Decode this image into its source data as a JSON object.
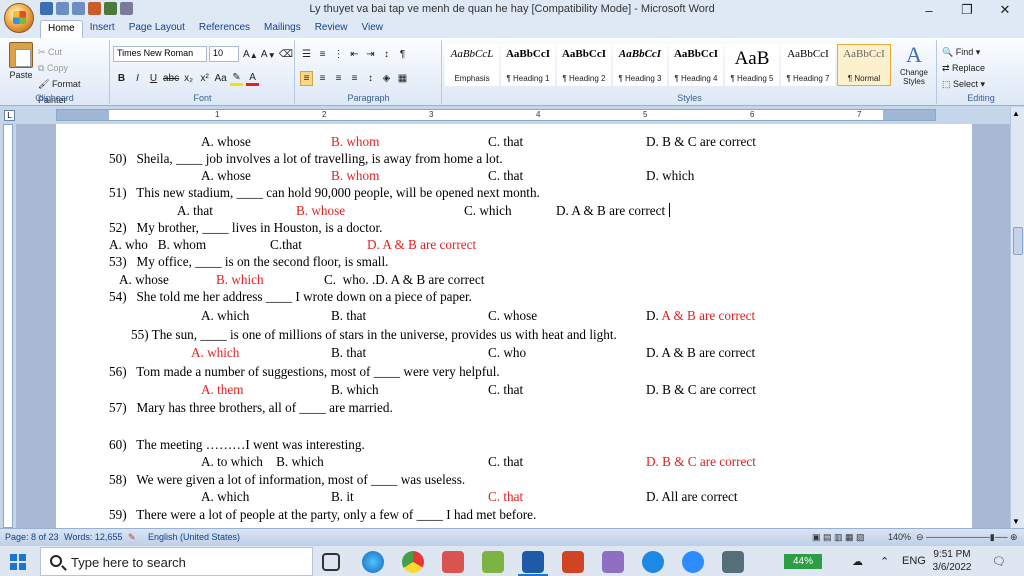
{
  "window": {
    "title": "Ly thuyet va bai tap ve menh de quan he hay [Compatibility Mode] - Microsoft Word",
    "minimize": "–",
    "restore": "❐",
    "close": "✕"
  },
  "tabs": [
    "Home",
    "Insert",
    "Page Layout",
    "References",
    "Mailings",
    "Review",
    "View"
  ],
  "ribbon": {
    "clipboard": {
      "paste": "Paste",
      "cut": "Cut",
      "copy": "Copy",
      "format_painter": "Format Painter",
      "label": "Clipboard"
    },
    "font": {
      "name": "Times New Roman",
      "size": "10",
      "label": "Font"
    },
    "paragraph": {
      "label": "Paragraph"
    },
    "styles": {
      "label": "Styles",
      "items": [
        {
          "preview": "AaBbCcL",
          "name": "Emphasis"
        },
        {
          "preview": "AaBbCcI",
          "name": "¶ Heading 1"
        },
        {
          "preview": "AaBbCcI",
          "name": "¶ Heading 2"
        },
        {
          "preview": "AaBbCcI",
          "name": "¶ Heading 3"
        },
        {
          "preview": "AaBbCcI",
          "name": "¶ Heading 4"
        },
        {
          "preview": "AaB",
          "name": "¶ Heading 5"
        },
        {
          "preview": "AaBbCcI",
          "name": "¶ Heading 7"
        },
        {
          "preview": "AaBbCcI",
          "name": "¶ Normal"
        }
      ],
      "change_styles": "Change Styles"
    },
    "editing": {
      "find": "Find",
      "replace": "Replace",
      "select": "Select",
      "label": "Editing"
    }
  },
  "ruler_numbers": [
    "1",
    "2",
    "3",
    "4",
    "5",
    "6",
    "7"
  ],
  "document": {
    "lines": [
      {
        "segs": [
          {
            "t": "A. whose"
          }
        ]
      },
      {
        "segs": [
          {
            "t": "B. whom",
            "red": true
          }
        ]
      },
      {
        "segs": [
          {
            "t": "C. that"
          }
        ]
      },
      {
        "segs": [
          {
            "t": "D. B & C are correct"
          }
        ]
      },
      {
        "segs": [
          {
            "t": "50)   Sheila, ____ job involves a lot of travelling, is away from home a lot."
          }
        ]
      },
      {
        "segs": [
          {
            "t": "A. whose"
          }
        ]
      },
      {
        "segs": [
          {
            "t": "B. whom",
            "red": true
          }
        ]
      },
      {
        "segs": [
          {
            "t": "C. that"
          }
        ]
      },
      {
        "segs": [
          {
            "t": "D. which"
          }
        ]
      },
      {
        "segs": [
          {
            "t": "51)   This new stadium, ____ can hold 90,000 people, will be opened next month."
          }
        ]
      },
      {
        "segs": [
          {
            "t": "A. that"
          }
        ]
      },
      {
        "segs": [
          {
            "t": "B. whose",
            "red": true
          }
        ]
      },
      {
        "segs": [
          {
            "t": "C. which"
          }
        ]
      },
      {
        "segs": [
          {
            "t": "D. A & B are correct"
          }
        ]
      },
      {
        "segs": [
          {
            "t": "52)   My brother, ____ lives in Houston, is a doctor."
          }
        ]
      },
      {
        "segs": [
          {
            "t": "A. who   B. whom"
          }
        ]
      },
      {
        "segs": [
          {
            "t": "C.that"
          }
        ]
      },
      {
        "segs": [
          {
            "t": "D. A & B are correct",
            "red": true
          }
        ]
      },
      {
        "segs": [
          {
            "t": "53)   My office, ____ is on the second floor, is small."
          }
        ]
      },
      {
        "segs": [
          {
            "t": "A. whose"
          }
        ]
      },
      {
        "segs": [
          {
            "t": "B. which",
            "red": true
          }
        ]
      },
      {
        "segs": [
          {
            "t": "C.  who. .D. A & B are correct"
          }
        ]
      },
      {
        "segs": [
          {
            "t": "54)   She told me her address ____ I wrote down on a piece of paper."
          }
        ]
      },
      {
        "segs": [
          {
            "t": "A. which"
          }
        ]
      },
      {
        "segs": [
          {
            "t": "B. that"
          }
        ]
      },
      {
        "segs": [
          {
            "t": "C. whose"
          }
        ]
      },
      {
        "segs": [
          {
            "t": "D. "
          },
          {
            "t": "A & B are correct",
            "red": true
          }
        ]
      },
      {
        "segs": [
          {
            "t": "55) The sun, ____ is one of millions of stars in the universe, provides us with heat and light."
          }
        ]
      },
      {
        "segs": [
          {
            "t": "A. which",
            "red": true
          }
        ]
      },
      {
        "segs": [
          {
            "t": "B. that"
          }
        ]
      },
      {
        "segs": [
          {
            "t": "C. who"
          }
        ]
      },
      {
        "segs": [
          {
            "t": "D. A & B are correct"
          }
        ]
      },
      {
        "segs": [
          {
            "t": "56)   Tom made a number of suggestions, most of ____ were very helpful."
          }
        ]
      },
      {
        "segs": [
          {
            "t": "A. them",
            "red": true
          }
        ]
      },
      {
        "segs": [
          {
            "t": "B. which"
          }
        ]
      },
      {
        "segs": [
          {
            "t": "C. that"
          }
        ]
      },
      {
        "segs": [
          {
            "t": "D. B & C are correct"
          }
        ]
      },
      {
        "segs": [
          {
            "t": "57)   Mary has three brothers, all of ____ are married."
          }
        ]
      },
      {
        "segs": [
          {
            "t": "60)   The meeting ………I went was interesting."
          }
        ]
      },
      {
        "segs": [
          {
            "t": "A. to which    B. which"
          }
        ]
      },
      {
        "segs": [
          {
            "t": "C. that"
          }
        ]
      },
      {
        "segs": [
          {
            "t": "D. B & C are correct",
            "red": true
          }
        ]
      },
      {
        "segs": [
          {
            "t": "58)   We were given a lot of information, most of ____ was useless."
          }
        ]
      },
      {
        "segs": [
          {
            "t": "A. which"
          }
        ]
      },
      {
        "segs": [
          {
            "t": "B. it"
          }
        ]
      },
      {
        "segs": [
          {
            "t": "C. that",
            "red": true
          }
        ]
      },
      {
        "segs": [
          {
            "t": "D. All are correct"
          }
        ]
      },
      {
        "segs": [
          {
            "t": "59)   There were a lot of people at the party, only a few of ____ I had met before."
          }
        ]
      }
    ]
  },
  "status": {
    "page": "Page: 8 of 23",
    "words": "Words: 12,655",
    "language": "English (United States)",
    "zoom": "140%"
  },
  "taskbar": {
    "search_placeholder": "Type here to search",
    "battery": "44%",
    "lang": "ENG",
    "time": "9:51 PM",
    "date": "3/6/2022"
  }
}
